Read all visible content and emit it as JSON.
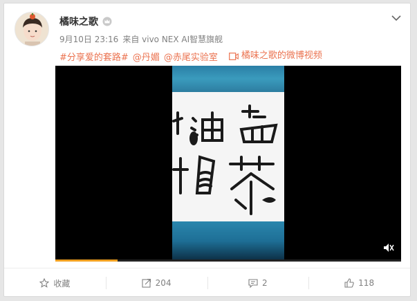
{
  "post": {
    "username": "橘味之歌",
    "meta": {
      "date": "9月10日 23:16",
      "source": "来自 vivo NEX AI智慧旗舰"
    },
    "tags": [
      "#分享爱的套路#",
      "@丹媚",
      "@赤尾实验室"
    ],
    "video_link": "橘味之歌的微博视频"
  },
  "video": {
    "progress_percent": 18
  },
  "actions": {
    "favorite": "收藏",
    "repost": "204",
    "comment": "2",
    "like": "118"
  },
  "icons": [
    "crown-badge-icon",
    "chevron-down-icon",
    "video-icon",
    "mute-icon",
    "star-icon",
    "repost-icon",
    "comment-icon",
    "thumbs-up-icon"
  ],
  "colors": {
    "link": "#eb7350",
    "text": "#333333",
    "meta": "#808080",
    "progress": "#f0a020"
  }
}
